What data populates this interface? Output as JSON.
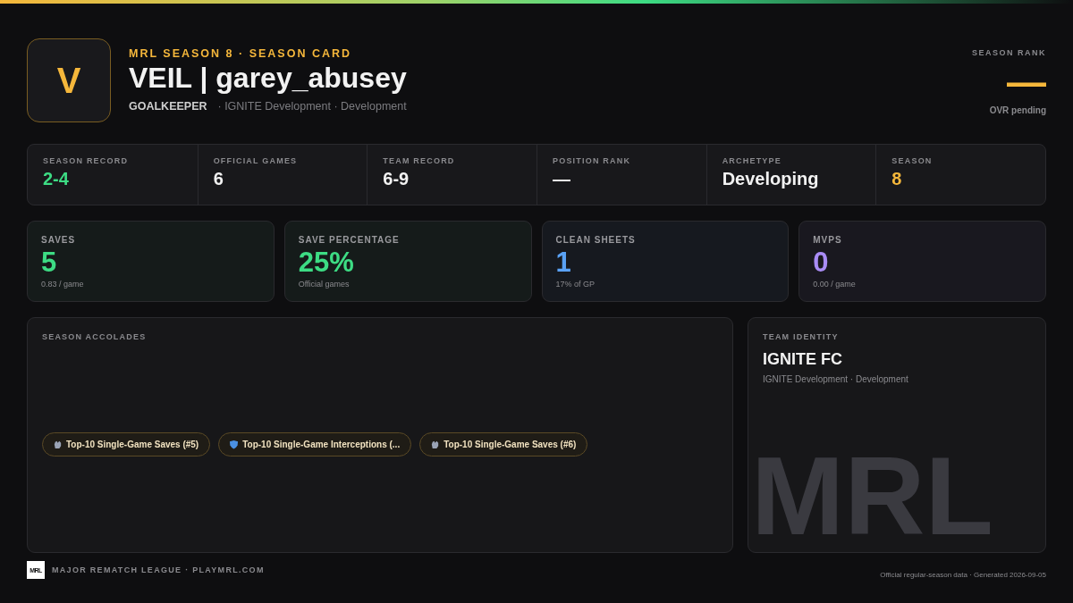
{
  "header": {
    "avatar_letter": "V",
    "eyebrow": "MRL SEASON 8 · SEASON CARD",
    "title": "VEIL | garey_abusey",
    "position": "GOALKEEPER",
    "team_line": "· IGNITE Development · Development"
  },
  "season_rank": {
    "label": "SEASON RANK",
    "value": "—",
    "note": "OVR pending"
  },
  "stats": [
    {
      "label": "SEASON RECORD",
      "value": "2-4",
      "color": "#3ddc84"
    },
    {
      "label": "OFFICIAL GAMES",
      "value": "6",
      "color": "#f2f2f2"
    },
    {
      "label": "TEAM RECORD",
      "value": "6-9",
      "color": "#f2f2f2"
    },
    {
      "label": "POSITION RANK",
      "value": "—",
      "color": "#f2f2f2"
    },
    {
      "label": "ARCHETYPE",
      "value": "Developing",
      "color": "#f2f2f2"
    },
    {
      "label": "SEASON",
      "value": "8",
      "color": "#f5b73b"
    }
  ],
  "metrics": [
    {
      "label": "SAVES",
      "value": "5",
      "sub": "0.83 / game",
      "color": "#3ddc84"
    },
    {
      "label": "SAVE PERCENTAGE",
      "value": "25%",
      "sub": "Official games",
      "color": "#3ddc84"
    },
    {
      "label": "CLEAN SHEETS",
      "value": "1",
      "sub": "17% of GP",
      "color": "#5aa2f5"
    },
    {
      "label": "MVPS",
      "value": "0",
      "sub": "0.00 / game",
      "color": "#a98cf5"
    }
  ],
  "accolades": {
    "title": "SEASON ACCOLADES",
    "items": [
      {
        "kind": "glove",
        "text": "Top-10 Single-Game Saves (#5)"
      },
      {
        "kind": "shield",
        "text": "Top-10 Single-Game Interceptions (..."
      },
      {
        "kind": "glove",
        "text": "Top-10 Single-Game Saves (#6)"
      }
    ]
  },
  "team_identity": {
    "title": "TEAM IDENTITY",
    "name": "IGNITE FC",
    "sub": "IGNITE Development · Development"
  },
  "footer": {
    "logo_text": "MRL",
    "league": "MAJOR REMATCH LEAGUE · PLAYMRL.COM",
    "note": "Official regular-season data · Generated 2026-09-05",
    "backdrop_text": "MRL"
  }
}
